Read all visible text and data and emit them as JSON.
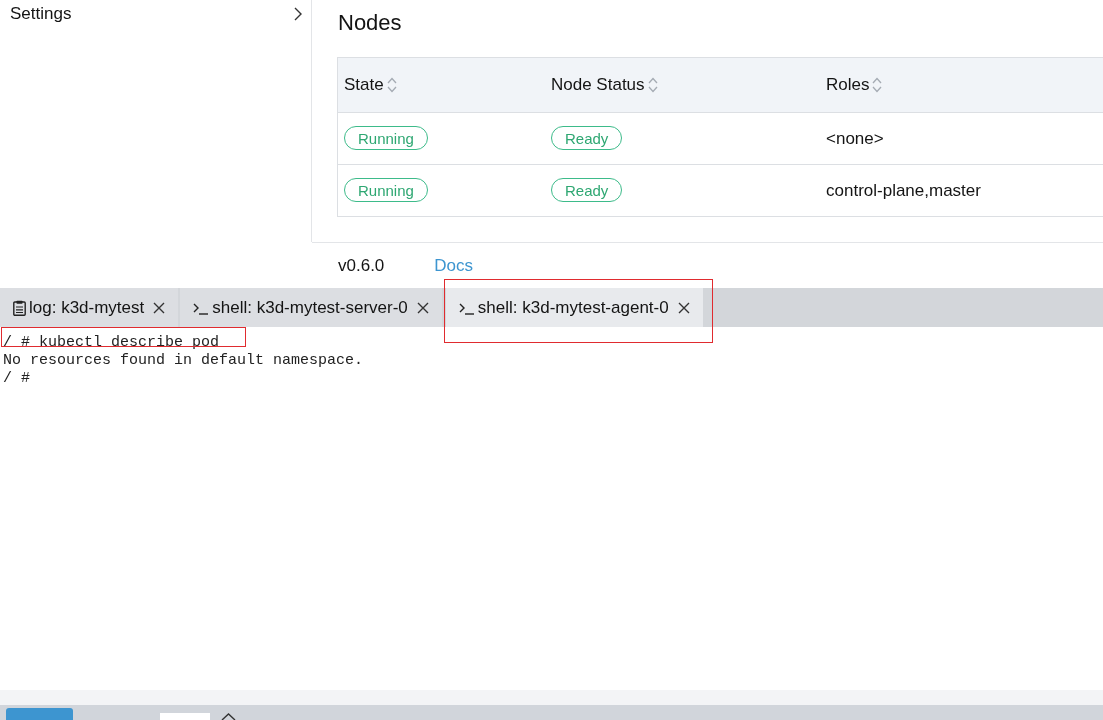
{
  "sidebar": {
    "items": [
      {
        "label": "Settings"
      }
    ]
  },
  "nodes": {
    "title": "Nodes",
    "columns": [
      {
        "label": "State",
        "sortable": true
      },
      {
        "label": "Node Status",
        "sortable": true
      },
      {
        "label": "Roles",
        "sortable": true
      }
    ],
    "rows": [
      {
        "state": "Running",
        "node_status": "Ready",
        "roles": "<none>"
      },
      {
        "state": "Running",
        "node_status": "Ready",
        "roles": "control-plane,master"
      }
    ]
  },
  "footer": {
    "version": "v0.6.0",
    "links": [
      {
        "label": "Docs"
      }
    ]
  },
  "terminal": {
    "tabs": [
      {
        "kind": "log",
        "label": "log: k3d-mytest",
        "selected": false,
        "highlighted": false
      },
      {
        "kind": "shell",
        "label": "shell: k3d-mytest-server-0",
        "selected": false,
        "highlighted": false
      },
      {
        "kind": "shell",
        "label": "shell: k3d-mytest-agent-0",
        "selected": true,
        "highlighted": true
      }
    ],
    "lines": [
      {
        "text": "/ # kubectl describe pod",
        "highlighted": true
      },
      {
        "text": "No resources found in default namespace.",
        "highlighted": false
      },
      {
        "text": "/ #",
        "highlighted": false
      }
    ]
  }
}
